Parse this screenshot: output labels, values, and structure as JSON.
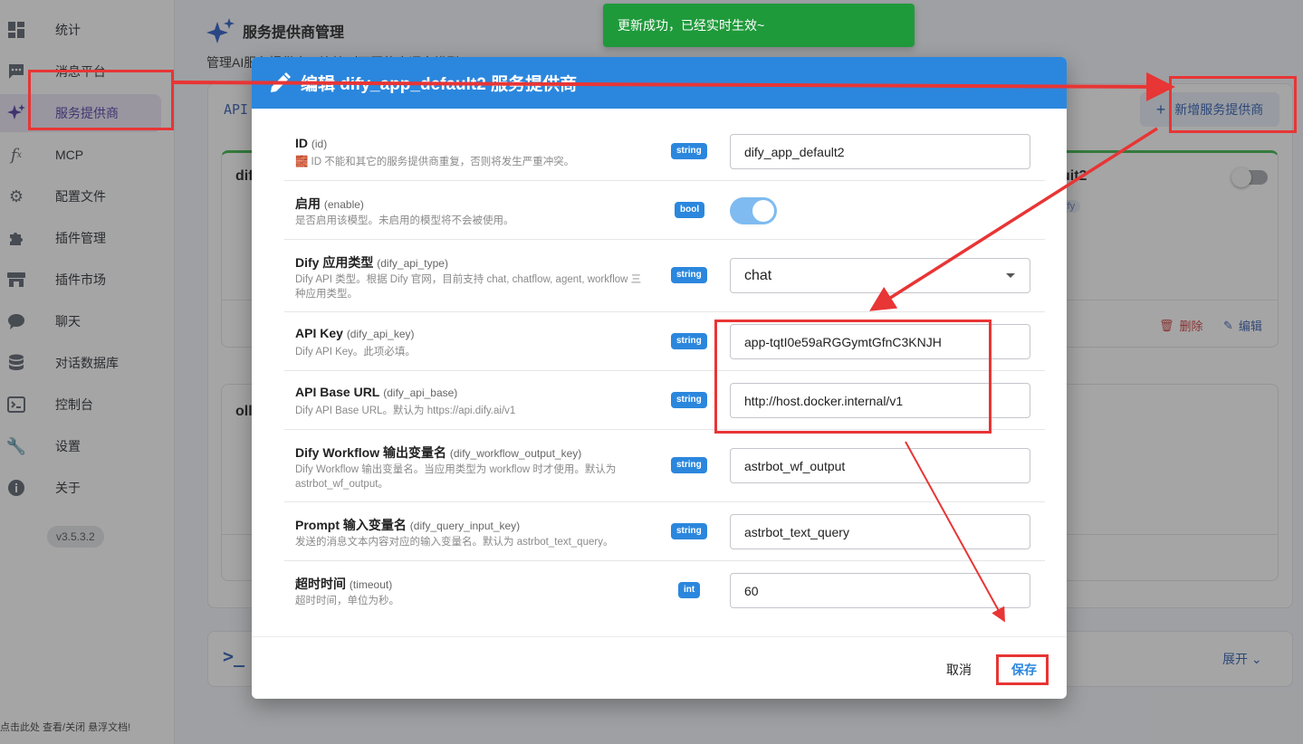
{
  "sidebar": {
    "items": [
      {
        "label": "统计",
        "icon": "dashboard-icon"
      },
      {
        "label": "消息平台",
        "icon": "message-icon"
      },
      {
        "label": "服务提供商",
        "icon": "sparkle-icon"
      },
      {
        "label": "MCP",
        "icon": "function-icon"
      },
      {
        "label": "配置文件",
        "icon": "gear-icon"
      },
      {
        "label": "插件管理",
        "icon": "puzzle-icon"
      },
      {
        "label": "插件市场",
        "icon": "store-icon"
      },
      {
        "label": "聊天",
        "icon": "chat-bubble-icon"
      },
      {
        "label": "对话数据库",
        "icon": "database-icon"
      },
      {
        "label": "控制台",
        "icon": "console-icon"
      },
      {
        "label": "设置",
        "icon": "wrench-icon"
      },
      {
        "label": "关于",
        "icon": "info-icon"
      }
    ],
    "active_index": 2,
    "version": "v3.5.3.2",
    "docs_tip": "点击此处 查看/关闭 悬浮文档!"
  },
  "page": {
    "title": "服务提供商管理",
    "subtitle": "管理AI服务提供商，连接到不同的大语言模型",
    "panel_label": "API",
    "add_button": "新增服务提供商",
    "card1_title": "dif",
    "card2_title": "oll",
    "right_card_title": "uit2",
    "right_card_tag": "dify",
    "delete_label": "删除",
    "edit_label": "编辑",
    "expand_label": "展开"
  },
  "toast": {
    "message": "更新成功，已经实时生效~"
  },
  "dialog": {
    "title": "编辑 dify_app_default2 服务提供商",
    "fields": [
      {
        "name": "ID",
        "key": "(id)",
        "desc": "🧱 ID 不能和其它的服务提供商重复，否则将发生严重冲突。",
        "type": "string",
        "value": "dify_app_default2"
      },
      {
        "name": "启用",
        "key": "(enable)",
        "desc": "是否启用该模型。未启用的模型将不会被使用。",
        "type": "bool",
        "value": "true"
      },
      {
        "name": "Dify 应用类型",
        "key": "(dify_api_type)",
        "desc": "Dify API 类型。根据 Dify 官网，目前支持 chat, chatflow, agent, workflow 三种应用类型。",
        "type": "string",
        "value": "chat"
      },
      {
        "name": "API Key",
        "key": "(dify_api_key)",
        "desc": "Dify API Key。此项必填。",
        "type": "string",
        "value": "app-tqtI0e59aRGGymtGfnC3KNJH"
      },
      {
        "name": "API Base URL",
        "key": "(dify_api_base)",
        "desc": "Dify API Base URL。默认为 https://api.dify.ai/v1",
        "type": "string",
        "value": "http://host.docker.internal/v1"
      },
      {
        "name": "Dify Workflow 输出变量名",
        "key": "(dify_workflow_output_key)",
        "desc": "Dify Workflow 输出变量名。当应用类型为 workflow 时才使用。默认为 astrbot_wf_output。",
        "type": "string",
        "value": "astrbot_wf_output"
      },
      {
        "name": "Prompt 输入变量名",
        "key": "(dify_query_input_key)",
        "desc": "发送的消息文本内容对应的输入变量名。默认为 astrbot_text_query。",
        "type": "string",
        "value": "astrbot_text_query"
      },
      {
        "name": "超时时间",
        "key": "(timeout)",
        "desc": "超时时间，单位为秒。",
        "type": "int",
        "value": "60"
      }
    ],
    "cancel": "取消",
    "save": "保存"
  },
  "colors": {
    "primary": "#2b87dd",
    "annotation": "#e83535",
    "toast": "#1f9a3b",
    "active_nav": "#4e3ea3"
  }
}
